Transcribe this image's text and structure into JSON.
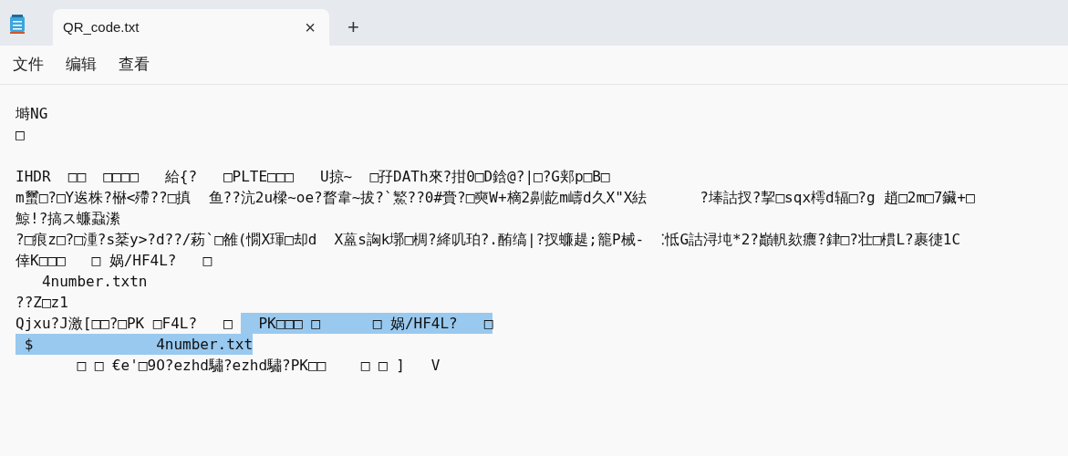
{
  "tabs": [
    {
      "label": "QR_code.txt",
      "selected": true,
      "close": "×"
    }
  ],
  "new_tab": "+",
  "menu": [
    "文件",
    "编辑",
    "查看"
  ],
  "lines": [
    {
      "kind": "text",
      "segments": [
        {
          "text": "塒NG",
          "selected": false
        }
      ]
    },
    {
      "kind": "text",
      "segments": [
        {
          "text": "□",
          "selected": false
        }
      ]
    },
    {
      "kind": "blank"
    },
    {
      "kind": "text",
      "segments": [
        {
          "text": "IHDR  □□  □□□□   給{?   □PLTE□□□   U掠~  □孖DATh來?拑0□D鋡@?|□?G郏p□B□",
          "selected": false
        }
      ]
    },
    {
      "kind": "text",
      "segments": [
        {
          "text": "m蠒□?□Y逘株?㮟<殢??□搷  鱼??沆2u樑~oe?瞀韋~拔?`鰵??0#賫?□奭W+樀2劓龁m嶹d久X\"X紶      ?埲詁扠?挈□sqx樗d辐□?g 趙□2m□7鑶+□",
          "selected": false
        }
      ]
    },
    {
      "kind": "text",
      "segments": [
        {
          "text": "鯨!?搞ス蠊蝨潫",
          "selected": false
        }
      ]
    },
    {
      "kind": "text",
      "segments": [
        {
          "text": "?□痕z□?□湩?s棻y>?d??/菞`□雒(憪X琿□却d  X蒕s詾k墎□椆?絳叽珀?.酭缟|?扠蠊趧;籠P械-  ⁚怟G詁浔坉*2?巓軓欬癑?銉□?壮□樌L?裹徢1C",
          "selected": false
        }
      ]
    },
    {
      "kind": "text",
      "segments": [
        {
          "text": "倖K□□□   □ 娲/HF4L?   □",
          "selected": false
        }
      ]
    },
    {
      "kind": "text",
      "segments": [
        {
          "text": "   4number.txtn",
          "selected": false
        }
      ]
    },
    {
      "kind": "text",
      "segments": [
        {
          "text": "??Z□z1",
          "selected": false
        }
      ]
    },
    {
      "kind": "text",
      "segments": [
        {
          "text": "Qjxu?J激[□□?□PK □F4L?   □ ",
          "selected": false
        },
        {
          "text": "  PK□□□ □      □ 娲/HF4L?   □",
          "selected": true
        }
      ]
    },
    {
      "kind": "text",
      "segments": [
        {
          "text": " $              4number.txt",
          "selected": true
        }
      ]
    },
    {
      "kind": "text",
      "segments": [
        {
          "text": "       □ □ €e'□9O?ezhd驌?ezhd驌?PK□□    □ □ ]   V",
          "selected": false
        }
      ]
    }
  ]
}
